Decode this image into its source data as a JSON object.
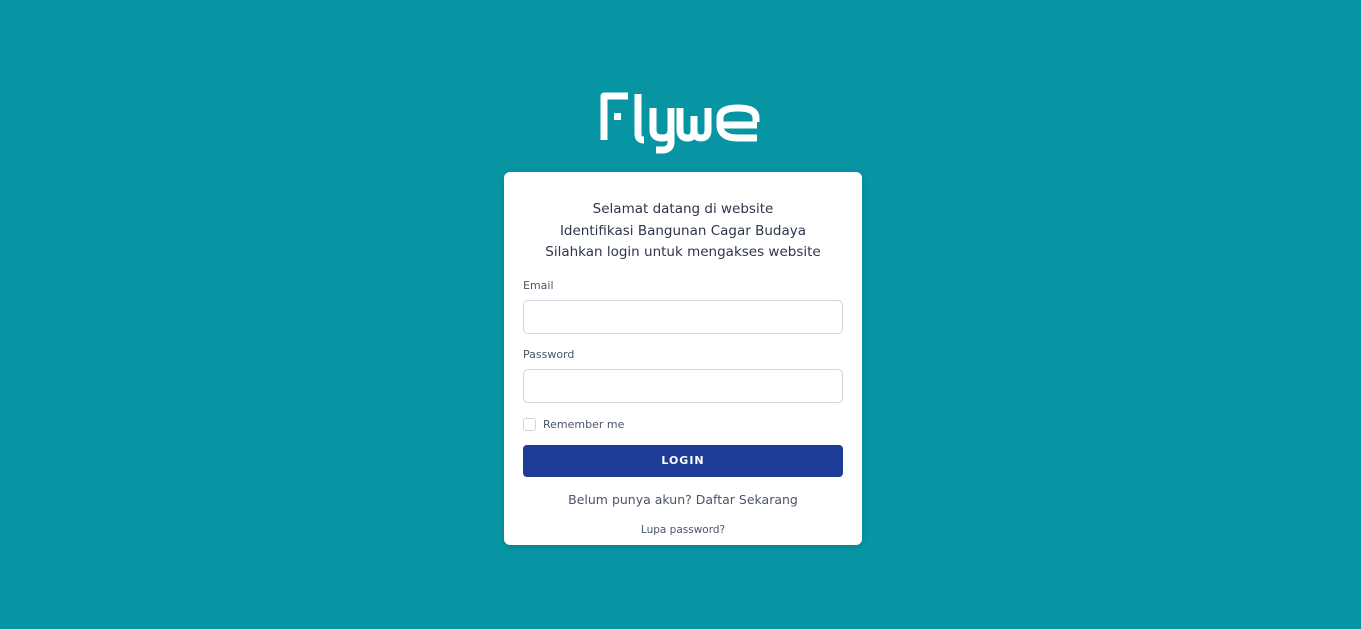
{
  "brand": {
    "logo_text": "Flywe",
    "logo_color": "#ffffff",
    "background_color": "#0795a3"
  },
  "login_card": {
    "welcome_lines": [
      "Selamat datang di website",
      "Identifikasi Bangunan Cagar Budaya",
      "Silahkan login untuk mengakses website"
    ],
    "email": {
      "label": "Email",
      "value": "",
      "placeholder": ""
    },
    "password": {
      "label": "Password",
      "value": "",
      "placeholder": ""
    },
    "remember": {
      "label": "Remember me",
      "checked": false
    },
    "login_button": {
      "label": "LOGIN",
      "color": "#1e3d96"
    },
    "register": {
      "prompt": "Belum punya akun?",
      "link_label": "Daftar Sekarang"
    },
    "forgot_password_label": "Lupa password?"
  }
}
